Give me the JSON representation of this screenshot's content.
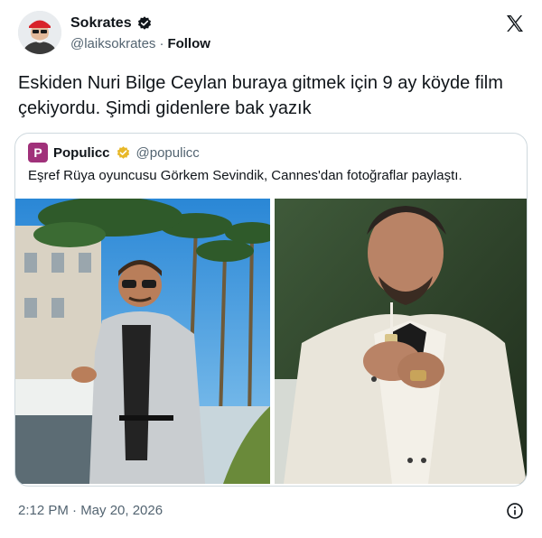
{
  "tweet": {
    "author_name": "Sokrates",
    "author_handle": "@laiksokrates",
    "separator": "·",
    "follow_label": "Follow",
    "text": "Eskiden Nuri Bilge Ceylan buraya gitmek için 9 ay köyde film çekiyordu. Şimdi gidenlere bak yazık",
    "timestamp": "2:12 PM · May 20, 2026"
  },
  "quote": {
    "avatar_letter": "P",
    "author_name": "Populicc",
    "author_handle": "@populicc",
    "text": "Eşref Rüya oyuncusu Görkem Sevindik, Cannes'dan fotoğraflar paylaştı."
  },
  "colors": {
    "verified_blue": "#1d9bf0",
    "verified_gold": "#e8b829",
    "populicc_brand": "#a0317a",
    "secondary_text": "#536471"
  },
  "icons": {
    "brand": "x-logo-icon",
    "info": "info-icon",
    "verified": "verified-badge-icon"
  }
}
